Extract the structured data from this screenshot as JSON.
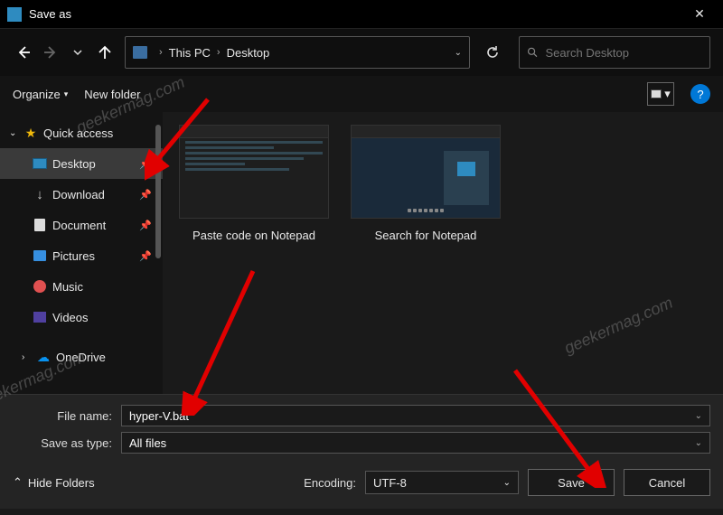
{
  "window": {
    "title": "Save as"
  },
  "breadcrumb": {
    "parts": [
      "This PC",
      "Desktop"
    ]
  },
  "search": {
    "placeholder": "Search Desktop"
  },
  "toolbar": {
    "organize": "Organize",
    "new_folder": "New folder"
  },
  "sidebar": {
    "quick_access": "Quick access",
    "items": [
      {
        "label": "Desktop",
        "pinned": true,
        "icon": "desktop"
      },
      {
        "label": "Download",
        "pinned": true,
        "icon": "download"
      },
      {
        "label": "Document",
        "pinned": true,
        "icon": "document"
      },
      {
        "label": "Pictures",
        "pinned": true,
        "icon": "pictures"
      },
      {
        "label": "Music",
        "pinned": false,
        "icon": "music"
      },
      {
        "label": "Videos",
        "pinned": false,
        "icon": "videos"
      }
    ],
    "onedrive": "OneDrive"
  },
  "files": [
    {
      "name": "Paste code on Notepad"
    },
    {
      "name": "Search for Notepad"
    }
  ],
  "fields": {
    "file_name_label": "File name:",
    "file_name_value": "hyper-V.bat",
    "save_type_label": "Save as type:",
    "save_type_value": "All files",
    "encoding_label": "Encoding:",
    "encoding_value": "UTF-8"
  },
  "footer": {
    "hide_folders": "Hide Folders",
    "save": "Save",
    "cancel": "Cancel"
  },
  "watermark": "geekermag.com"
}
